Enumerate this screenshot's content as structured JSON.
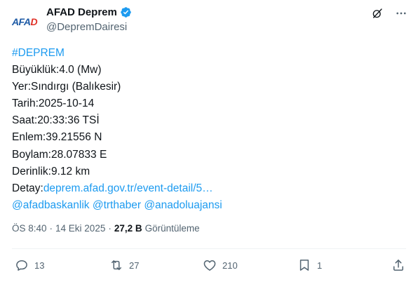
{
  "author": {
    "avatar_text_blue": "AFA",
    "avatar_text_red": "D",
    "name": "AFAD Deprem",
    "handle": "@DepremDairesi"
  },
  "tweet": {
    "hashtag": "#DEPREM",
    "lines": [
      "Büyüklük:4.0 (Mw)",
      "Yer:Sındırgı (Balıkesir)",
      "Tarih:2025-10-14",
      "Saat:20:33:36 TSİ",
      "Enlem:39.21556 N",
      "Boylam:28.07833 E",
      "Derinlik:9.12 km"
    ],
    "detail_label": "Detay:",
    "detail_link": "deprem.afad.gov.tr/event-detail/5…",
    "mentions": [
      "@afadbaskanlik",
      "@trthaber",
      "@anadoluajansi"
    ]
  },
  "meta": {
    "time": "ÖS 8:40",
    "separator": "·",
    "date": "14 Eki 2025",
    "views_count": "27,2 B",
    "views_label": "Görüntüleme"
  },
  "actions": {
    "replies": "13",
    "reposts": "27",
    "likes": "210",
    "bookmarks": "1"
  },
  "colors": {
    "link": "#1d9bf0",
    "verified": "#1d9bf0",
    "secondary_text": "#536471"
  }
}
